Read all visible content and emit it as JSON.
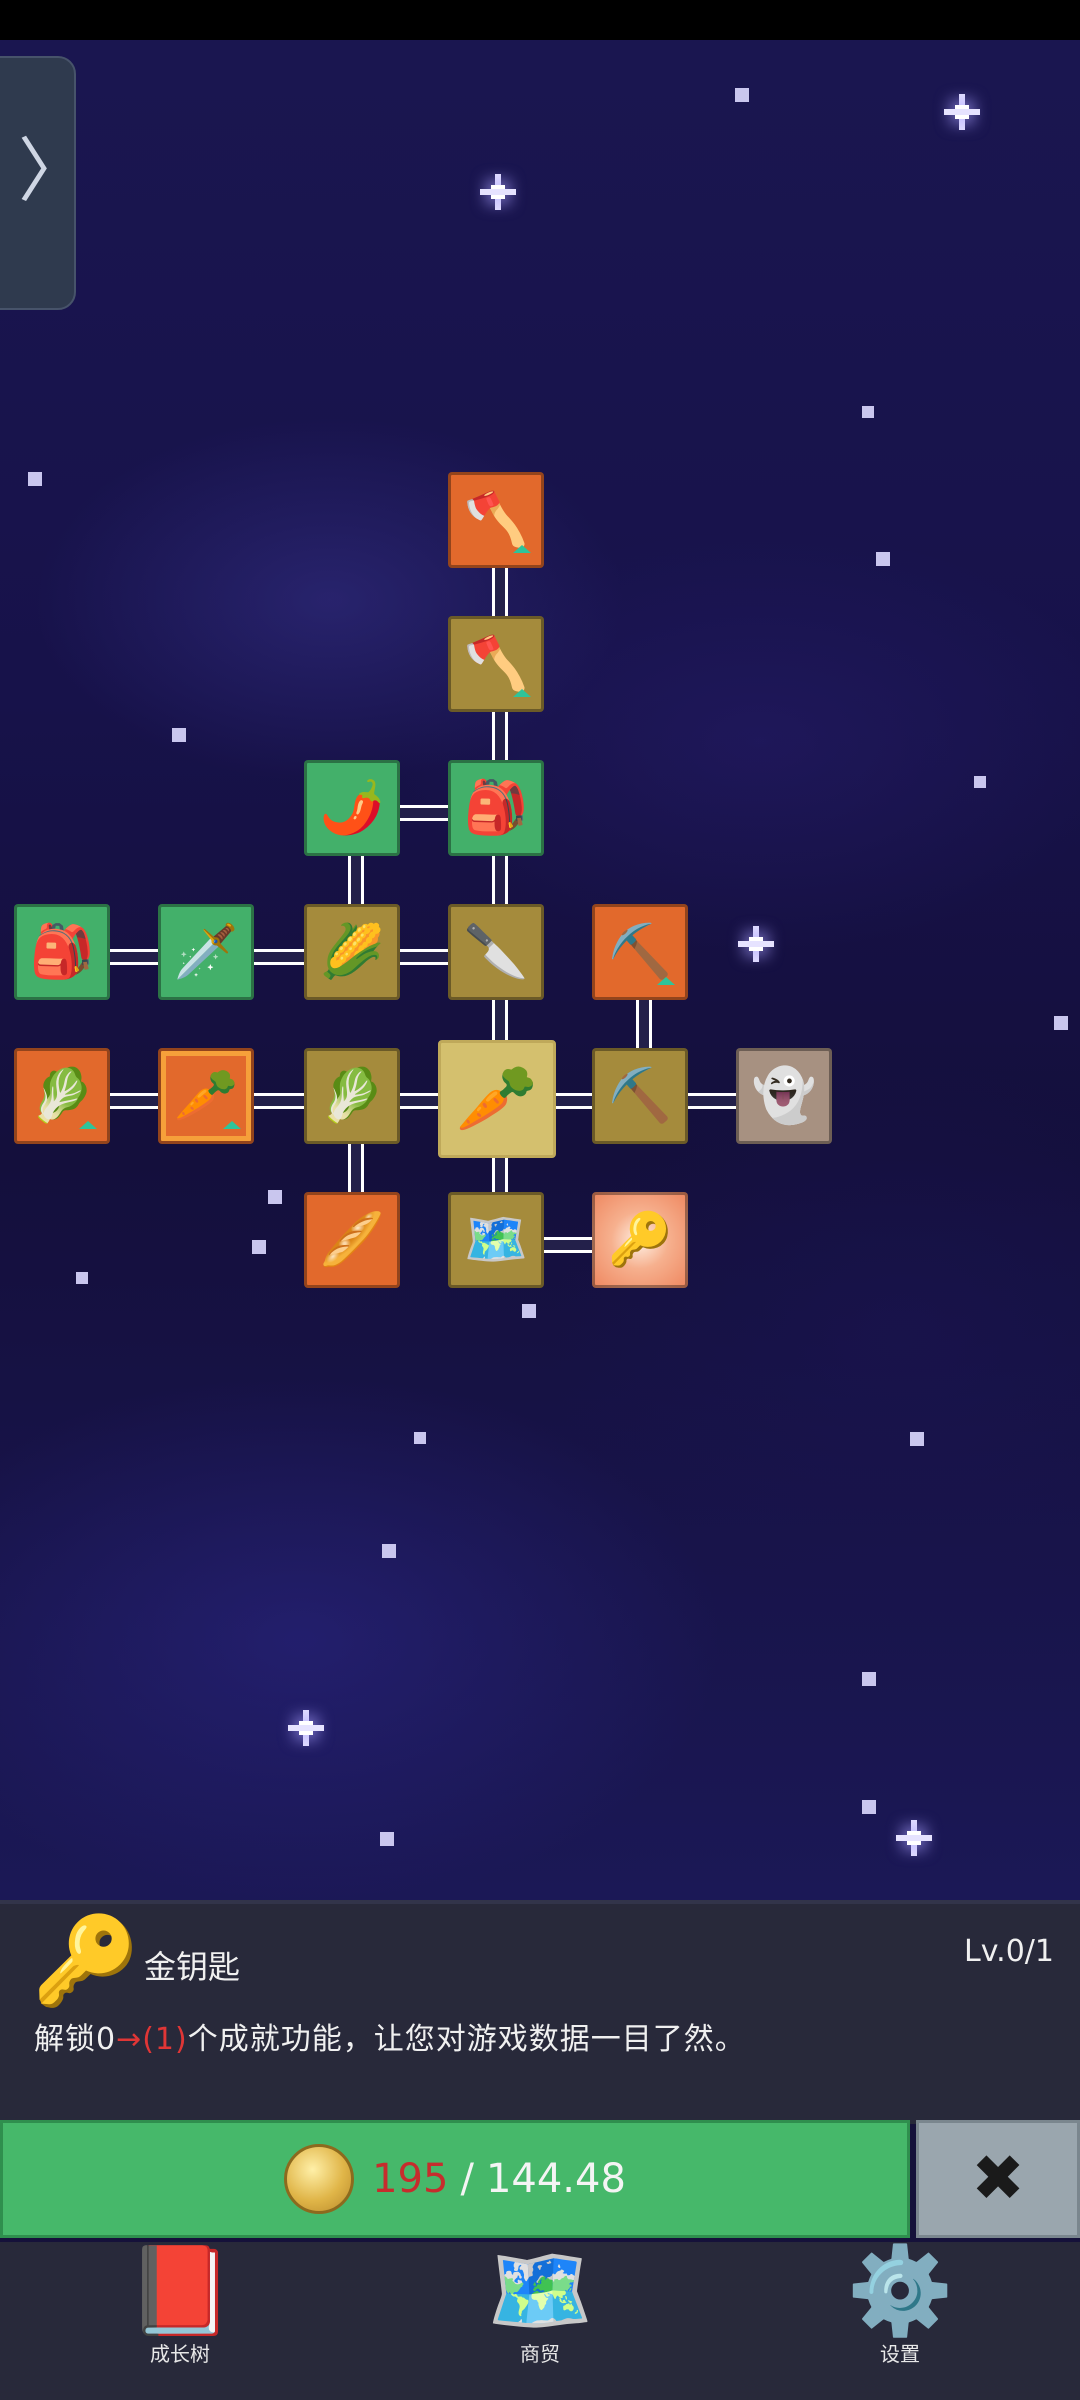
{
  "skill_tree": {
    "nodes": [
      {
        "id": "shovel-top",
        "icon": "shovel-icon",
        "glyph": "🪓",
        "color": "orange",
        "upgrade": true
      },
      {
        "id": "shovel-mid",
        "icon": "shovel-icon",
        "glyph": "🪓",
        "color": "gold",
        "upgrade": true
      },
      {
        "id": "backpack-top",
        "icon": "backpack-icon",
        "glyph": "🎒",
        "color": "green",
        "upgrade": false
      },
      {
        "id": "chili",
        "icon": "chili-pepper-icon",
        "glyph": "🌶️",
        "color": "green",
        "upgrade": false
      },
      {
        "id": "backpack-left",
        "icon": "backpack-icon",
        "glyph": "🎒",
        "color": "green",
        "upgrade": false
      },
      {
        "id": "sword",
        "icon": "sword-icon",
        "glyph": "🗡️",
        "color": "green",
        "upgrade": false
      },
      {
        "id": "corn",
        "icon": "corn-icon",
        "glyph": "🌽",
        "color": "gold",
        "upgrade": false
      },
      {
        "id": "dagger",
        "icon": "dagger-icon",
        "glyph": "🔪",
        "color": "gold",
        "upgrade": false
      },
      {
        "id": "pickaxe-top",
        "icon": "pickaxe-icon",
        "glyph": "⛏️",
        "color": "orange",
        "upgrade": true
      },
      {
        "id": "cabbage-left",
        "icon": "cabbage-icon",
        "glyph": "🥬",
        "color": "orange",
        "upgrade": true
      },
      {
        "id": "carrot-selected",
        "icon": "carrot-icon",
        "glyph": "🥕",
        "color": "orange",
        "upgrade": true
      },
      {
        "id": "cabbage-mid",
        "icon": "cabbage-icon",
        "glyph": "🥬",
        "color": "gold",
        "upgrade": false
      },
      {
        "id": "carrot-center",
        "icon": "carrot-icon",
        "glyph": "🥕",
        "color": "center",
        "upgrade": false
      },
      {
        "id": "pickaxe-mid",
        "icon": "pickaxe-icon",
        "glyph": "⛏️",
        "color": "gold",
        "upgrade": false
      },
      {
        "id": "ghost",
        "icon": "hooded-figure-icon",
        "glyph": "👻",
        "color": "orange",
        "upgrade": false
      },
      {
        "id": "root",
        "icon": "root-icon",
        "glyph": "🥖",
        "color": "orange",
        "upgrade": false
      },
      {
        "id": "map",
        "icon": "map-icon",
        "glyph": "🗺️",
        "color": "gold",
        "upgrade": false
      },
      {
        "id": "golden-key",
        "icon": "golden-key-icon",
        "glyph": "🔑",
        "color": "radiant",
        "upgrade": false
      }
    ]
  },
  "info": {
    "icon": "golden-key-icon",
    "glyph": "🔑",
    "title": "金钥匙",
    "level": "Lv.0/1",
    "desc_prefix": "解锁0",
    "desc_arrow": "→(1)",
    "desc_suffix": "个成就功能，让您对游戏数据一目了然。"
  },
  "purchase": {
    "current": "195",
    "separator": "/",
    "required": "144.48",
    "coin_icon": "coin-icon",
    "close_icon": "close-icon"
  },
  "nav": {
    "items": [
      {
        "label": "成长树",
        "icon": "book-icon",
        "glyph": "📕"
      },
      {
        "label": "商贸",
        "icon": "map-icon",
        "glyph": "🗺️"
      },
      {
        "label": "设置",
        "icon": "gear-icon",
        "glyph": "⚙️"
      }
    ]
  },
  "colors": {
    "orange": "#e2692c",
    "gold": "#a58b3c",
    "green": "#43b06a",
    "buy_button": "#46b86a",
    "price_current": "#c62d2d"
  }
}
